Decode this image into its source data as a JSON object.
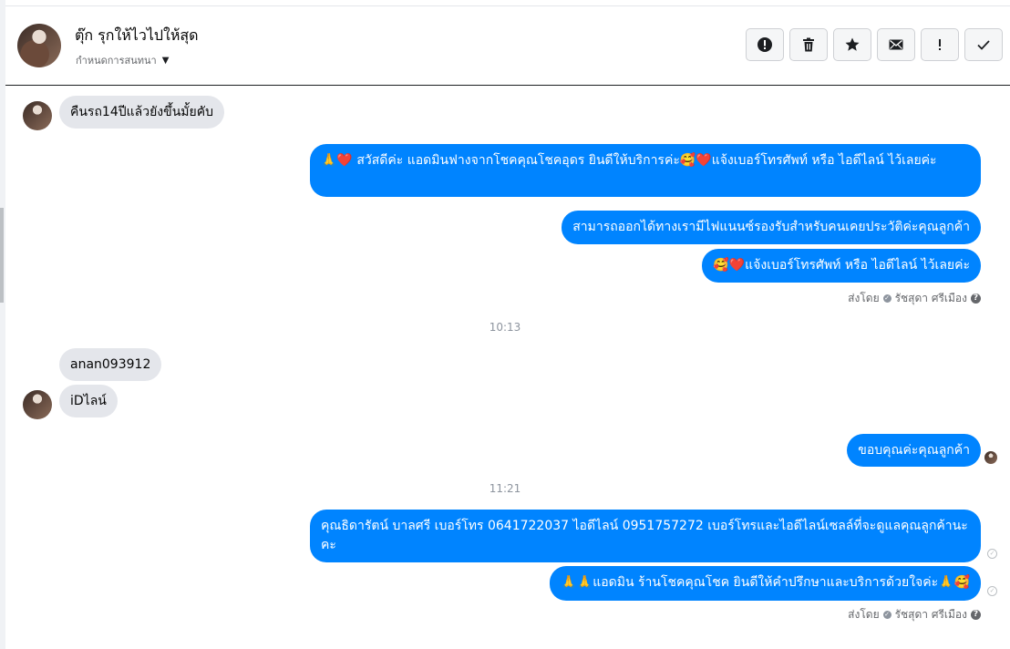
{
  "header": {
    "contact_name": "ตุ๊ก รุกให้ไวไปให้สุด",
    "conversation_setting": "กำหนดการสนทนา"
  },
  "toolbar": {
    "actions": [
      "alert-icon",
      "trash-icon",
      "star-icon",
      "mail-icon",
      "exclamation-icon",
      "check-icon"
    ]
  },
  "messages": {
    "m1": "คืนรถ14ปีแล้วยังขึ้นมั้ยคับ",
    "m2": "🙏❤️ สวัสดีค่ะ แอดมินฟางจากโชคคุณโชคอุดร ยินดีให้บริการค่ะ🥰❤️แจ้งเบอร์โทรศัพท์ หรือ ไอดีไลน์  ไว้เลยค่ะ",
    "m3": "สามารถออกได้ทางเรามีไฟแนนซ์รองรับสำหรับคนเคยประวัติค่ะคุณลูกค้า",
    "m4": "🥰❤️แจ้งเบอร์โทรศัพท์ หรือ ไอดีไลน์  ไว้เลยค่ะ",
    "sent_by_1": "ส่งโดย ",
    "sender_1": "รัชสุดา ศรีเมือง",
    "time_1": "10:13",
    "m5": "anan093912",
    "m6": "iDไลน์",
    "m7": "ขอบคุณค่ะคุณลูกค้า",
    "time_2": "11:21",
    "m8": "คุณธิดารัตน์ บาลศรี เบอร์โทร 0641722037  ไอดีไลน์ 0951757272  เบอร์โทรและไอดีไลน์เซลล์ที่จะดูแลคุณลูกค้านะคะ",
    "m9": "🙏🙏แอดมิน ร้านโชคคุณโชค ยินดีให้คำปรึกษาและบริการด้วยใจค่ะ🙏🥰",
    "sent_by_2": "ส่งโดย ",
    "sender_2": "รัชสุดา ศรีเมือง"
  },
  "colors": {
    "outgoing_bubble": "#0084ff",
    "incoming_bubble": "#e4e6eb"
  }
}
